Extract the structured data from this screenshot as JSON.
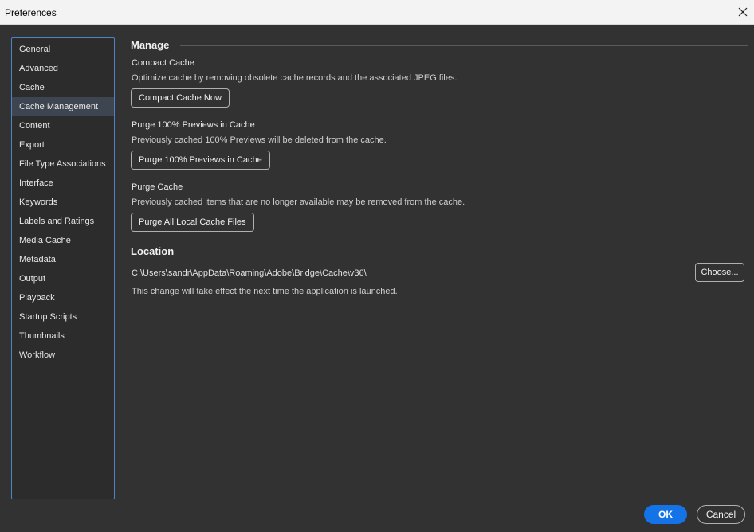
{
  "window": {
    "title": "Preferences"
  },
  "sidebar": {
    "items": [
      {
        "label": "General"
      },
      {
        "label": "Advanced"
      },
      {
        "label": "Cache"
      },
      {
        "label": "Cache Management",
        "selected": true
      },
      {
        "label": "Content"
      },
      {
        "label": "Export"
      },
      {
        "label": "File Type Associations"
      },
      {
        "label": "Interface"
      },
      {
        "label": "Keywords"
      },
      {
        "label": "Labels and Ratings"
      },
      {
        "label": "Media Cache"
      },
      {
        "label": "Metadata"
      },
      {
        "label": "Output"
      },
      {
        "label": "Playback"
      },
      {
        "label": "Startup Scripts"
      },
      {
        "label": "Thumbnails"
      },
      {
        "label": "Workflow"
      }
    ]
  },
  "manage": {
    "header": "Manage",
    "compact": {
      "title": "Compact Cache",
      "description": "Optimize cache by removing obsolete cache records and the associated JPEG files.",
      "button": "Compact Cache Now"
    },
    "purge_previews": {
      "title": "Purge 100% Previews in Cache",
      "description": "Previously cached 100% Previews will be deleted from the cache.",
      "button": "Purge 100% Previews in Cache"
    },
    "purge_cache": {
      "title": "Purge Cache",
      "description": "Previously cached items that are no longer available may be removed from the cache.",
      "button": "Purge All Local Cache Files"
    }
  },
  "location": {
    "header": "Location",
    "path": "C:\\Users\\sandr\\AppData\\Roaming\\Adobe\\Bridge\\Cache\\v36\\",
    "note": "This change will take effect the next time the application is launched.",
    "choose_button": "Choose..."
  },
  "footer": {
    "ok": "OK",
    "cancel": "Cancel"
  },
  "colors": {
    "accent": "#1473e6",
    "background": "#323232",
    "sidebar_border": "#4b85c8",
    "selected_item": "#3d4550"
  },
  "icons": {
    "close": "close-icon"
  }
}
